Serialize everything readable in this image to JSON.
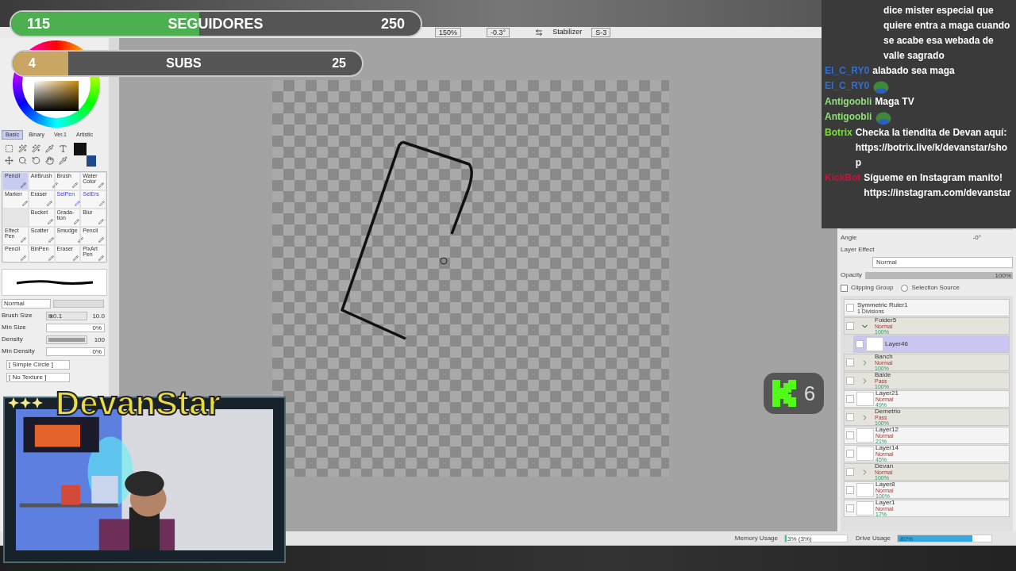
{
  "toolbar": {
    "items": [
      "150%",
      "-0.3°",
      "Stabilizer",
      "S-3"
    ]
  },
  "followers": {
    "current": "115",
    "label": "SEGUIDORES",
    "goal": "250",
    "level": 0.46
  },
  "subs": {
    "current": "4",
    "label": "SUBS",
    "goal": "25",
    "level": 0.16
  },
  "tool_tabs": [
    {
      "label": "Basic",
      "selected": true
    },
    {
      "label": "Binary",
      "selected": false
    },
    {
      "label": "Ver.1",
      "selected": false
    },
    {
      "label": "Artistic",
      "selected": false
    }
  ],
  "tools": [
    {
      "kind": "tool",
      "label": "Pencil",
      "selected": true
    },
    {
      "kind": "tool",
      "label": "AirBrush",
      "selected": false
    },
    {
      "kind": "tool",
      "label": "Brush",
      "selected": false
    },
    {
      "kind": "tool",
      "label": "Water Color",
      "selected": false
    },
    {
      "kind": "tool",
      "label": "Marker",
      "selected": false
    },
    {
      "kind": "tool",
      "label": "Eraser",
      "selected": false
    },
    {
      "kind": "tool",
      "label": "SelPen",
      "selected": false
    },
    {
      "kind": "tool",
      "label": "SelErs",
      "selected": false
    },
    {
      "kind": "blank",
      "selected": false
    },
    {
      "kind": "tool",
      "label": "Bucket",
      "selected": false
    },
    {
      "kind": "tool",
      "label": "Grada-tion",
      "selected": false
    },
    {
      "kind": "tool",
      "label": "Blur",
      "selected": false
    },
    {
      "kind": "tool",
      "label": "Effect Pen",
      "selected": false
    },
    {
      "kind": "tool",
      "label": "Scatter",
      "selected": false
    },
    {
      "kind": "tool",
      "label": "Smudge",
      "selected": false
    },
    {
      "kind": "tool",
      "label": "Pencil",
      "selected": false
    },
    {
      "kind": "tool",
      "label": "Pencil",
      "selected": false
    },
    {
      "kind": "tool",
      "label": "BinPen",
      "selected": false
    },
    {
      "kind": "tool",
      "label": "Eraser",
      "selected": false
    },
    {
      "kind": "tool",
      "label": "PixArt Pen",
      "selected": false
    }
  ],
  "brush": {
    "mode": "Normal",
    "settings": [
      {
        "kind": "slider",
        "label": "Brush Size",
        "prefix": "x0.1",
        "value": "10.0",
        "level": 0.1
      },
      {
        "kind": "field",
        "label": "Min Size",
        "value": "0%"
      },
      {
        "kind": "slider",
        "label": "Density",
        "value": "100",
        "level": 1
      },
      {
        "kind": "field",
        "label": "Min Density",
        "value": "0%"
      }
    ],
    "shape": "[ Simple Circle ]",
    "texture": "[ No Texture ]"
  },
  "layer_props": {
    "angle_label": "Angle",
    "angle": "-0°",
    "effect": "Layer Effect",
    "mode": "Normal",
    "opacity_label": "Opacity",
    "opacity": "100%",
    "opacity_bar": {
      "level": 1
    },
    "clipping": {
      "label": "Clipping Group",
      "checked": false
    },
    "selection": {
      "label": "Selection Source",
      "selected": false
    }
  },
  "layers": [
    {
      "kind": "ruler",
      "name": "Symmetric Ruler1",
      "mode": "1 Divisions",
      "selected": false
    },
    {
      "kind": "folder",
      "name": "Folder5",
      "mode": "Normal",
      "opacity": "100%",
      "selected": false,
      "expanded": true,
      "children": [
        {
          "kind": "layer",
          "name": "Layer46",
          "selected": true
        }
      ]
    },
    {
      "kind": "folder",
      "name": "Banch",
      "mode": "Normal",
      "opacity": "100%",
      "selected": false,
      "expanded": false
    },
    {
      "kind": "folder",
      "name": "Balde",
      "mode": "Pass",
      "opacity": "100%",
      "selected": false,
      "expanded": false
    },
    {
      "kind": "layer",
      "name": "Layer21",
      "mode": "Normal",
      "opacity": "49%",
      "selected": false
    },
    {
      "kind": "folder",
      "name": "Demetrio",
      "mode": "Pass",
      "opacity": "100%",
      "selected": false,
      "expanded": false
    },
    {
      "kind": "layer",
      "name": "Layer12",
      "mode": "Normal",
      "opacity": "21%",
      "selected": false
    },
    {
      "kind": "layer",
      "name": "Layer14",
      "mode": "Normal",
      "opacity": "45%",
      "selected": false
    },
    {
      "kind": "folder",
      "name": "Devan",
      "mode": "Normal",
      "opacity": "100%",
      "selected": false,
      "expanded": false
    },
    {
      "kind": "layer",
      "name": "Layer8",
      "mode": "Normal",
      "opacity": "100%",
      "selected": false
    },
    {
      "kind": "layer",
      "name": "Layer1",
      "mode": "Normal",
      "opacity": "17%",
      "selected": false
    }
  ],
  "status_bar": {
    "memory_label": "Memory Usage",
    "memory": "3% (3%)",
    "memory_bar": {
      "level": 0.03
    },
    "drive_label": "Drive Usage",
    "drive": "80%",
    "drive_bar": {
      "level": 0.8
    }
  },
  "chat": [
    {
      "kind": "text",
      "text": "dice mister especial que quiere entra a maga cuando se acabe esa webada de valle sagrado"
    },
    {
      "kind": "text",
      "user": "El_C_RY0",
      "color": "#2f6fd6",
      "text": "alabado sea maga"
    },
    {
      "kind": "emote",
      "user": "El_C_RY0",
      "color": "#2f6fd6"
    },
    {
      "kind": "text",
      "user": "Antigoobli",
      "color": "#8fe07a",
      "text": "Maga TV"
    },
    {
      "kind": "emote",
      "user": "Antigoobli",
      "color": "#8fe07a"
    },
    {
      "kind": "text",
      "user": "Botrix",
      "color": "#7ddf3a",
      "text": "Checka la tiendita de Devan aquí: https://botrix.live/k/devanstar/shop"
    },
    {
      "kind": "text",
      "user": "KickBot",
      "color": "#d0103a",
      "text": "Sígueme en Instagram manito! https://instagram.com/devanstar"
    }
  ],
  "streamer": {
    "name": "DevanStar"
  },
  "viewer_badge": {
    "count": "6"
  }
}
